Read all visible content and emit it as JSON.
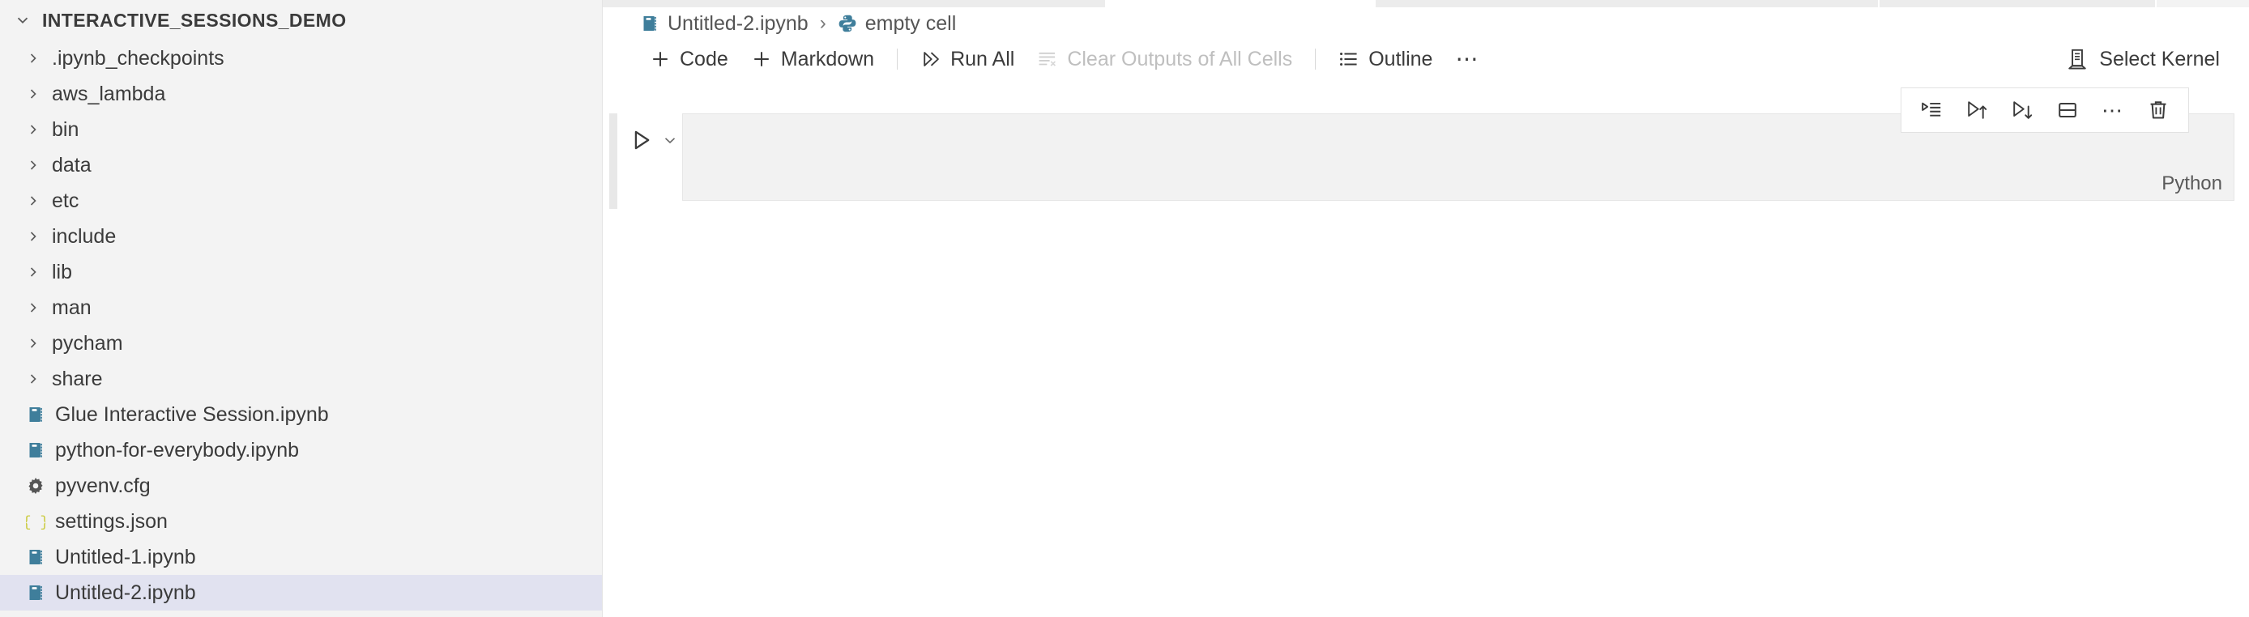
{
  "sidebar": {
    "header": {
      "label": "INTERACTIVE_SESSIONS_DEMO",
      "chevron_icon": "chevron-down-icon",
      "expanded": true
    },
    "items": [
      {
        "label": ".ipynb_checkpoints",
        "type": "dir",
        "icon": "chevron-right-icon",
        "selected": false
      },
      {
        "label": "aws_lambda",
        "type": "dir",
        "icon": "chevron-right-icon",
        "selected": false
      },
      {
        "label": "bin",
        "type": "dir",
        "icon": "chevron-right-icon",
        "selected": false
      },
      {
        "label": "data",
        "type": "dir",
        "icon": "chevron-right-icon",
        "selected": false
      },
      {
        "label": "etc",
        "type": "dir",
        "icon": "chevron-right-icon",
        "selected": false
      },
      {
        "label": "include",
        "type": "dir",
        "icon": "chevron-right-icon",
        "selected": false
      },
      {
        "label": "lib",
        "type": "dir",
        "icon": "chevron-right-icon",
        "selected": false
      },
      {
        "label": "man",
        "type": "dir",
        "icon": "chevron-right-icon",
        "selected": false
      },
      {
        "label": "pycham",
        "type": "dir",
        "icon": "chevron-right-icon",
        "selected": false
      },
      {
        "label": "share",
        "type": "dir",
        "icon": "chevron-right-icon",
        "selected": false
      },
      {
        "label": "Glue Interactive Session.ipynb",
        "type": "file",
        "icon": "notebook-icon",
        "selected": false
      },
      {
        "label": "python-for-everybody.ipynb",
        "type": "file",
        "icon": "notebook-icon",
        "selected": false
      },
      {
        "label": "pyvenv.cfg",
        "type": "file",
        "icon": "gear-icon",
        "selected": false
      },
      {
        "label": "settings.json",
        "type": "file",
        "icon": "json-icon",
        "selected": false
      },
      {
        "label": "Untitled-1.ipynb",
        "type": "file",
        "icon": "notebook-icon",
        "selected": false
      },
      {
        "label": "Untitled-2.ipynb",
        "type": "file",
        "icon": "notebook-icon",
        "selected": true
      }
    ]
  },
  "breadcrumb": {
    "file": {
      "label": "Untitled-2.ipynb",
      "icon": "notebook-icon"
    },
    "separator": "›",
    "cell": {
      "label": "empty cell",
      "icon": "python-icon"
    }
  },
  "toolbar": {
    "add_code_label": "Code",
    "add_code_icon": "plus-icon",
    "add_markdown_label": "Markdown",
    "add_markdown_icon": "plus-icon",
    "run_all_label": "Run All",
    "run_all_icon": "run-all-icon",
    "clear_outputs_label": "Clear Outputs of All Cells",
    "clear_outputs_icon": "clear-outputs-icon",
    "clear_outputs_disabled": true,
    "outline_label": "Outline",
    "outline_icon": "list-icon",
    "more_label": "⋯",
    "select_kernel_label": "Select Kernel",
    "select_kernel_icon": "kernel-icon"
  },
  "cell_toolbar": {
    "buttons": [
      {
        "icon": "run-by-line-icon",
        "title": "Run by Line"
      },
      {
        "icon": "run-above-icon",
        "title": "Execute Above Cells"
      },
      {
        "icon": "run-below-icon",
        "title": "Execute Cell and Below"
      },
      {
        "icon": "split-cell-icon",
        "title": "Split Cell"
      },
      {
        "icon": "more-actions-icon",
        "title": "More Actions",
        "glyph": "⋯"
      },
      {
        "icon": "trash-icon",
        "title": "Delete Cell"
      }
    ]
  },
  "cell": {
    "run_icon": "play-icon",
    "chevron_icon": "chevron-down-icon",
    "content": "",
    "language_label": "Python"
  },
  "colors": {
    "sidebar_bg": "#f3f3f3",
    "selected_row": "#e1e2f0",
    "notebook_icon": "#3f7e9b",
    "json_icon": "#cbcb41",
    "text": "#3b3b3b",
    "muted_text": "#bfbfbf",
    "cell_bg": "#f2f2f2"
  }
}
